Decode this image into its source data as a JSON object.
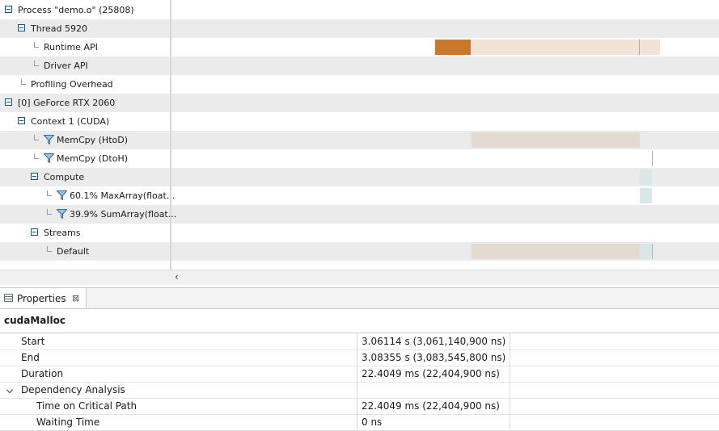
{
  "tree_rows": [
    {
      "label": "Process \"demo.o\" (25808)",
      "indent": 0,
      "expander": true,
      "connector": false,
      "filter": false
    },
    {
      "label": "Thread 5920",
      "indent": 1,
      "expander": true,
      "connector": false,
      "filter": false
    },
    {
      "label": "Runtime API",
      "indent": 2,
      "expander": false,
      "connector": true,
      "filter": false
    },
    {
      "label": "Driver API",
      "indent": 2,
      "expander": false,
      "connector": true,
      "filter": false
    },
    {
      "label": "Profiling Overhead",
      "indent": 1,
      "expander": false,
      "connector": true,
      "filter": false
    },
    {
      "label": "[0] GeForce RTX 2060",
      "indent": 0,
      "expander": true,
      "connector": false,
      "filter": false
    },
    {
      "label": "Context 1 (CUDA)",
      "indent": 1,
      "expander": true,
      "connector": false,
      "filter": false
    },
    {
      "label": "MemCpy (HtoD)",
      "indent": 2,
      "expander": false,
      "connector": true,
      "filter": true
    },
    {
      "label": "MemCpy (DtoH)",
      "indent": 2,
      "expander": false,
      "connector": true,
      "filter": true
    },
    {
      "label": "Compute",
      "indent": 2,
      "expander": true,
      "connector": false,
      "filter": false
    },
    {
      "label": "60.1% MaxArray(float...",
      "indent": 3,
      "expander": false,
      "connector": true,
      "filter": true
    },
    {
      "label": "39.9% SumArray(float...",
      "indent": 3,
      "expander": false,
      "connector": true,
      "filter": true
    },
    {
      "label": "Streams",
      "indent": 2,
      "expander": true,
      "connector": false,
      "filter": false
    },
    {
      "label": "Default",
      "indent": 3,
      "expander": false,
      "connector": true,
      "filter": false
    }
  ],
  "colors": {
    "selected_bar": "#c8772b",
    "runtime_bar": "#f3e3d6",
    "memcpy_bar": "#e3dbcf",
    "kernel_bar": "#d8e8e8",
    "tick": "#aaaaaa"
  },
  "properties": {
    "tab_title": "Properties",
    "close_icon": "⊠",
    "selected_title": "cudaMalloc",
    "rows": [
      {
        "name": "Start",
        "value": "3.06114 s (3,061,140,900 ns)",
        "level": 1,
        "expandable": false
      },
      {
        "name": "End",
        "value": "3.08355 s (3,083,545,800 ns)",
        "level": 1,
        "expandable": false
      },
      {
        "name": "Duration",
        "value": "22.4049 ms (22,404,900 ns)",
        "level": 1,
        "expandable": false
      },
      {
        "name": "Dependency Analysis",
        "value": "",
        "level": 1,
        "expandable": true
      },
      {
        "name": "Time on Critical Path",
        "value": "22.4049 ms (22,404,900 ns)",
        "level": 2,
        "expandable": false
      },
      {
        "name": "Waiting Time",
        "value": "0 ns",
        "level": 2,
        "expandable": false
      }
    ]
  },
  "scroll": {
    "left_arrow": "‹"
  }
}
